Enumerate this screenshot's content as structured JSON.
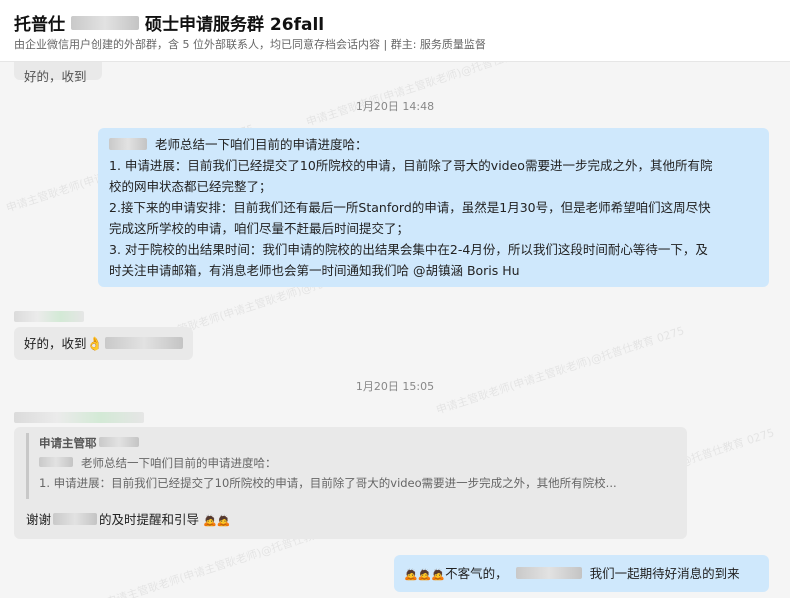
{
  "header": {
    "title_prefix": "托普仕",
    "title_suffix": "硕士申请服务群 26fall",
    "subtitle": "由企业微信用户创建的外部群，含 5 位外部联系人，均已同意存档会话内容 | 群主: 服务质量监督"
  },
  "messages": {
    "partial_text": "好的，收到",
    "timestamp1": "1月20日 14:48",
    "summary": {
      "line0": "老师总结一下咱们目前的申请进度哈：",
      "line1": "1. 申请进展：目前我们已经提交了10所院校的申请，目前除了哥大的video需要进一步完成之外，其他所有院",
      "line2": "校的网申状态都已经完整了；",
      "line3": "2.接下来的申请安排：目前我们还有最后一所Stanford的申请，虽然是1月30号，但是老师希望咱们这周尽快",
      "line4": "完成这所学校的申请，咱们尽量不赶最后时间提交了；",
      "line5": "3. 对于院校的出结果时间：我们申请的院校的出结果会集中在2-4月份，所以我们这段时间耐心等待一下，及",
      "line6": "时关注申请邮箱，有消息老师也会第一时间通知我们哈 @胡镇涵 Boris Hu"
    },
    "reply1_text": "好的，收到",
    "timestamp2": "1月20日 15:05",
    "quote": {
      "name": "申请主管耶",
      "line1": "老师总结一下咱们目前的申请进度哈：",
      "line2": "1. 申请进展：目前我们已经提交了10所院校的申请，目前除了哥大的video需要进一步完成之外，其他所有院校..."
    },
    "thanks_prefix": "谢谢",
    "thanks_suffix": "的及时提醒和引导",
    "final_prefix": "不客气的，",
    "final_suffix": "我们一起期待好消息的到来"
  },
  "watermark": "申请主管耿老师(申请主管耿老师)@托普仕教育 0275",
  "colors": {
    "bubble_left": "#e9e9e9",
    "bubble_right": "#cfe8fc",
    "chat_bg": "#f5f5f5"
  },
  "icons": [
    "ok-hand-emoji",
    "bow-emoji"
  ]
}
